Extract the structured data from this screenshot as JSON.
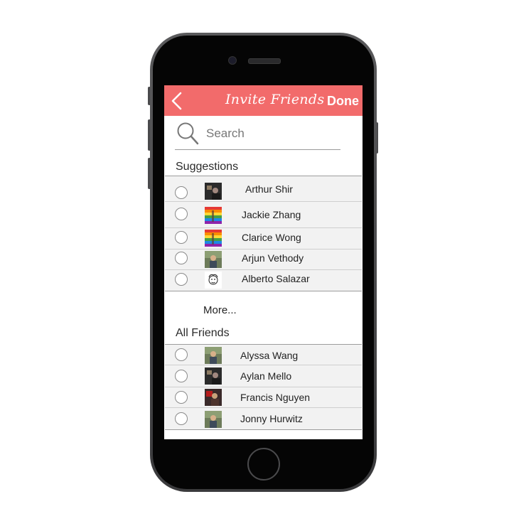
{
  "nav": {
    "title": "Invite Friends",
    "done_label": "Done"
  },
  "search": {
    "placeholder": "Search",
    "value": ""
  },
  "suggestions": {
    "title": "Suggestions",
    "items": [
      {
        "name": "Arthur Shir",
        "avatar": "photo-dark"
      },
      {
        "name": "Jackie Zhang",
        "avatar": "rainbow-flag-photo"
      },
      {
        "name": "Clarice Wong",
        "avatar": "rainbow-flag-photo"
      },
      {
        "name": "Arjun Vethody",
        "avatar": "person-photo"
      },
      {
        "name": "Alberto Salazar",
        "avatar": "sketch-face"
      }
    ]
  },
  "more_label": "More...",
  "all_friends": {
    "title": "All Friends",
    "items": [
      {
        "name": "Alyssa Wang",
        "avatar": "person-photo"
      },
      {
        "name": "Aylan Mello",
        "avatar": "photo-dark"
      },
      {
        "name": "Francis Nguyen",
        "avatar": "photo-red"
      },
      {
        "name": "Jonny Hurwitz",
        "avatar": "person-photo"
      }
    ]
  },
  "colors": {
    "accent": "#f26b6b",
    "row_bg": "#f2f2f2"
  }
}
